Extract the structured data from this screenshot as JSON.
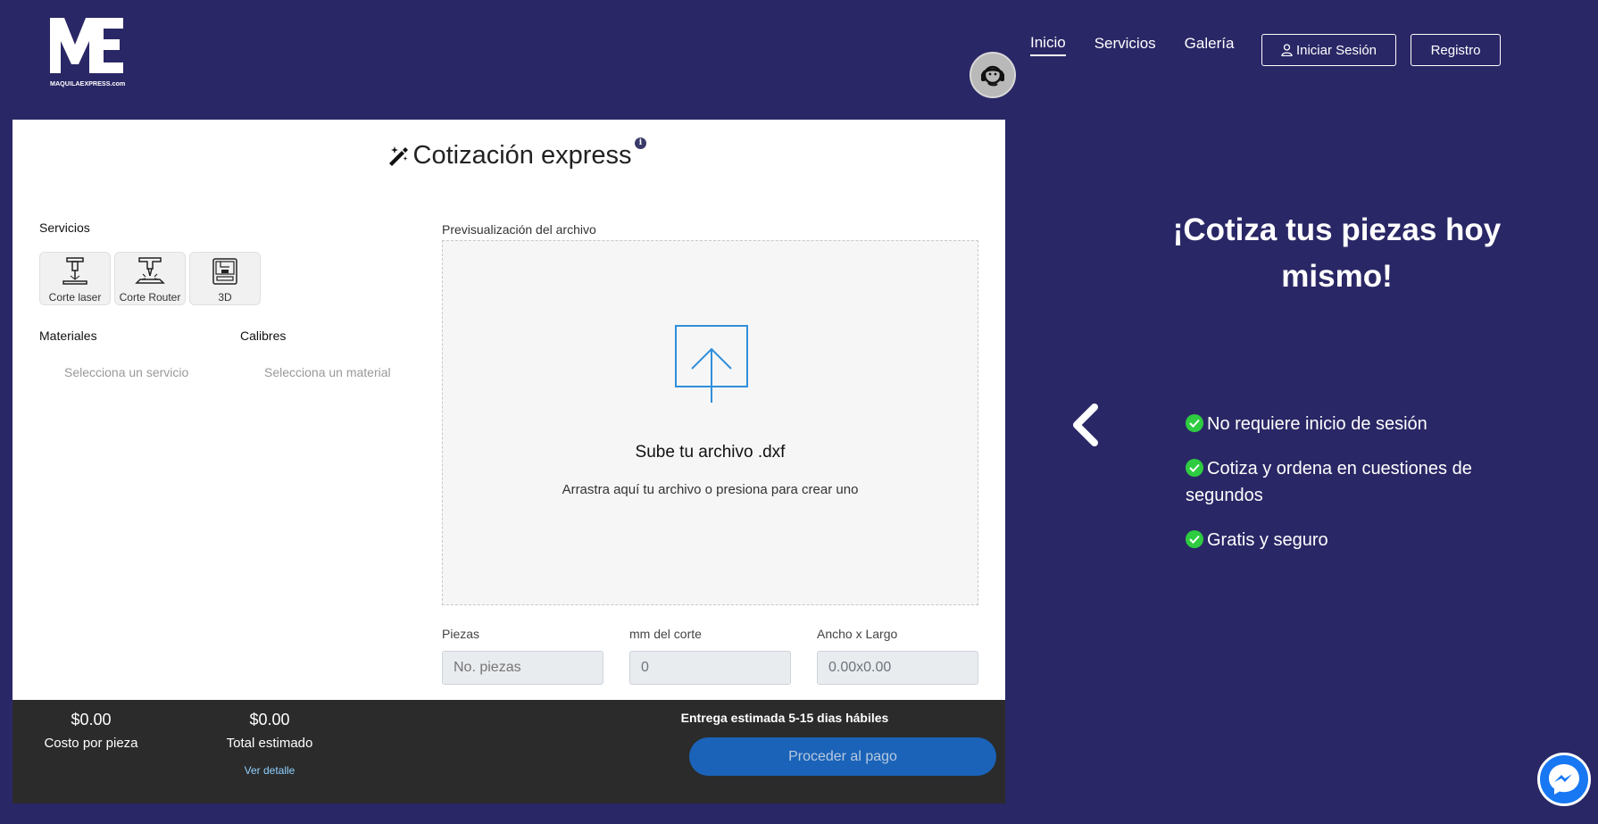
{
  "logo": {
    "text": "MAQUILAEXPRESS.com",
    "mark": "ME"
  },
  "nav": {
    "items": [
      {
        "label": "Inicio",
        "active": true
      },
      {
        "label": "Servicios",
        "active": false
      },
      {
        "label": "Galería",
        "active": false
      }
    ]
  },
  "auth": {
    "login_label": "Iniciar Sesión",
    "register_label": "Registro"
  },
  "quote": {
    "title": "Cotización express",
    "services_label": "Servicios",
    "services": [
      {
        "label": "Corte laser",
        "icon": "laser-cutter-icon"
      },
      {
        "label": "Corte Router",
        "icon": "router-cutter-icon"
      },
      {
        "label": "3D",
        "icon": "3d-printer-icon"
      }
    ],
    "materials_label": "Materiales",
    "materials_placeholder": "Selecciona un servicio",
    "gauges_label": "Calibres",
    "gauges_placeholder": "Selecciona un material",
    "preview_label": "Previsualización del archivo",
    "upload_title": "Sube tu archivo .dxf",
    "upload_subtitle": "Arrastra aquí tu archivo o presiona para crear uno",
    "pieces_label": "Piezas",
    "pieces_placeholder": "No. piezas",
    "cut_label": "mm del corte",
    "cut_value": "0",
    "size_label": "Ancho x Largo",
    "size_value": "0.00x0.00"
  },
  "summary": {
    "cost_per_piece": "$0.00",
    "cost_per_piece_label": "Costo por pieza",
    "total": "$0.00",
    "total_label": "Total estimado",
    "detail_link": "Ver detalle",
    "delivery": "Entrega estimada 5-15 dias hábiles",
    "pay_button": "Proceder al pago"
  },
  "promo": {
    "title": "¡Cotiza tus piezas hoy mismo!",
    "features": [
      "No requiere inicio de sesión",
      "Cotiza y ordena en cuestiones de segundos",
      "Gratis y seguro"
    ]
  },
  "colors": {
    "background": "#2a2766",
    "accent": "#1a63b8",
    "check": "#2ecc40",
    "bar": "#2b2b2b"
  }
}
